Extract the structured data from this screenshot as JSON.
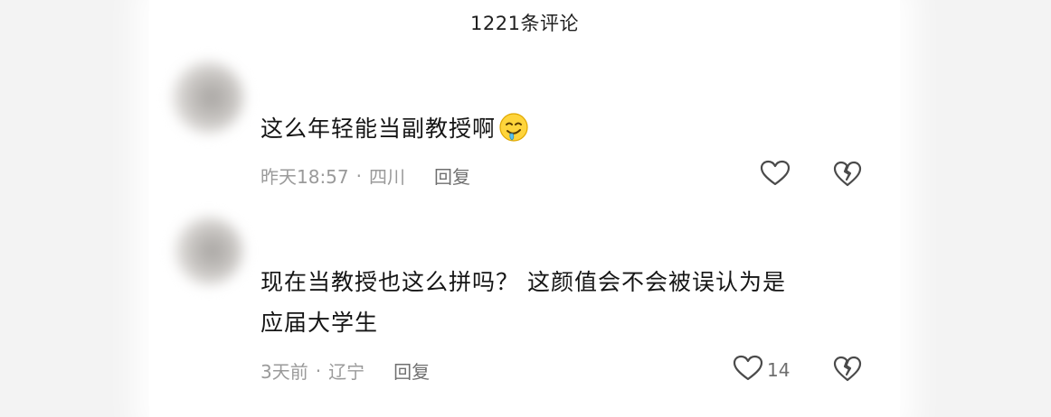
{
  "header": {
    "title": "1221条评论"
  },
  "comments": [
    {
      "text": "这么年轻能当副教授啊",
      "emoji_icon": "drooling-face-icon",
      "time": "昨天18:57",
      "separator": "·",
      "location": "四川",
      "reply_label": "回复",
      "like_count": ""
    },
    {
      "text_line1": "现在当教授也这么拼吗？ 这颜值会不会被误认为是",
      "text_line2": "应届大学生",
      "time": "3天前",
      "separator": "·",
      "location": "辽宁",
      "reply_label": "回复",
      "like_count": "14"
    }
  ],
  "colors": {
    "text": "#151515",
    "meta": "#9a9a9a",
    "icon": "#4a4a4a"
  }
}
